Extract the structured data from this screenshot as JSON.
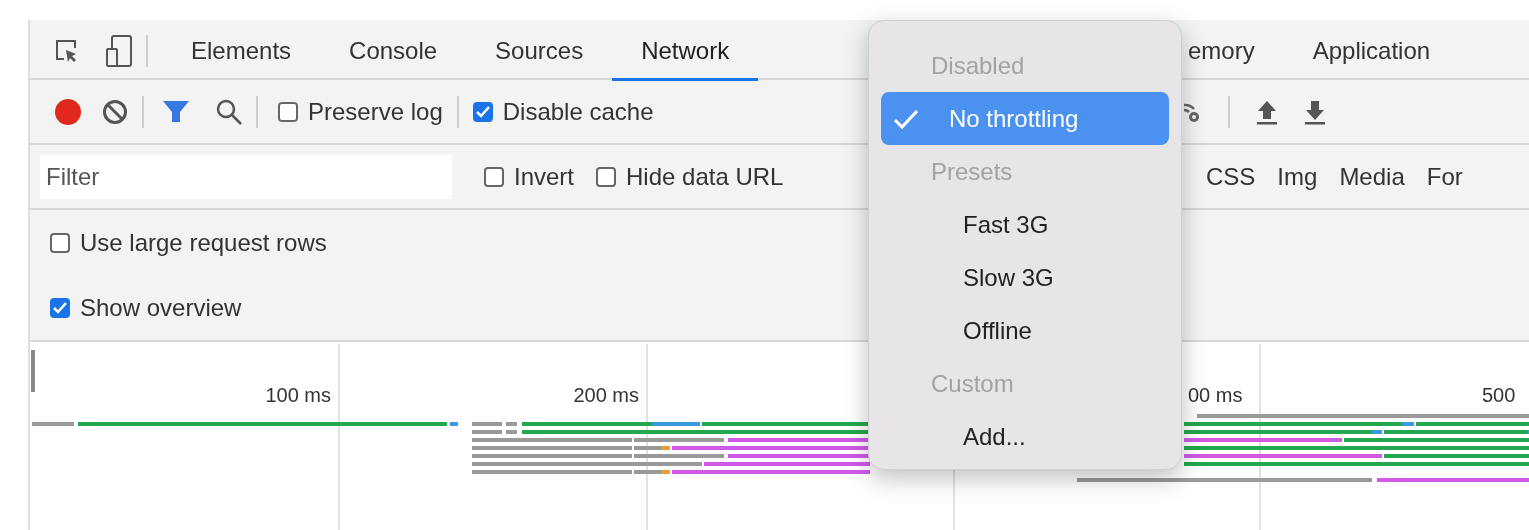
{
  "tabs": [
    {
      "label": "Elements",
      "selected": false
    },
    {
      "label": "Console",
      "selected": false
    },
    {
      "label": "Sources",
      "selected": false
    },
    {
      "label": "Network",
      "selected": true
    }
  ],
  "tabs_right": [
    {
      "label": "emory",
      "selected": false
    },
    {
      "label": "Application",
      "selected": false
    }
  ],
  "toolbar": {
    "recording": true,
    "checkboxes": [
      {
        "label": "Preserve log",
        "checked": false
      },
      {
        "label": "Disable cache",
        "checked": true
      }
    ]
  },
  "filter": {
    "placeholder": "Filter",
    "checkboxes": [
      {
        "label": "Invert",
        "checked": false
      },
      {
        "label": "Hide data URL",
        "checked": false
      }
    ],
    "types": [
      "CSS",
      "Img",
      "Media",
      "For"
    ]
  },
  "options": [
    {
      "label": "Use large request rows",
      "checked": false
    },
    {
      "label": "Show overview",
      "checked": true
    }
  ],
  "overview": {
    "ticks": [
      "100 ms",
      "200 ms",
      "00 ms",
      "500"
    ]
  },
  "throttling_menu": {
    "items": [
      {
        "kind": "header",
        "label": "Disabled"
      },
      {
        "kind": "option",
        "label": "No throttling",
        "selected": true
      },
      {
        "kind": "header",
        "label": "Presets"
      },
      {
        "kind": "option",
        "label": "Fast 3G",
        "selected": false
      },
      {
        "kind": "option",
        "label": "Slow 3G",
        "selected": false
      },
      {
        "kind": "option",
        "label": "Offline",
        "selected": false
      },
      {
        "kind": "header",
        "label": "Custom"
      },
      {
        "kind": "option",
        "label": "Add...",
        "selected": false
      }
    ]
  }
}
